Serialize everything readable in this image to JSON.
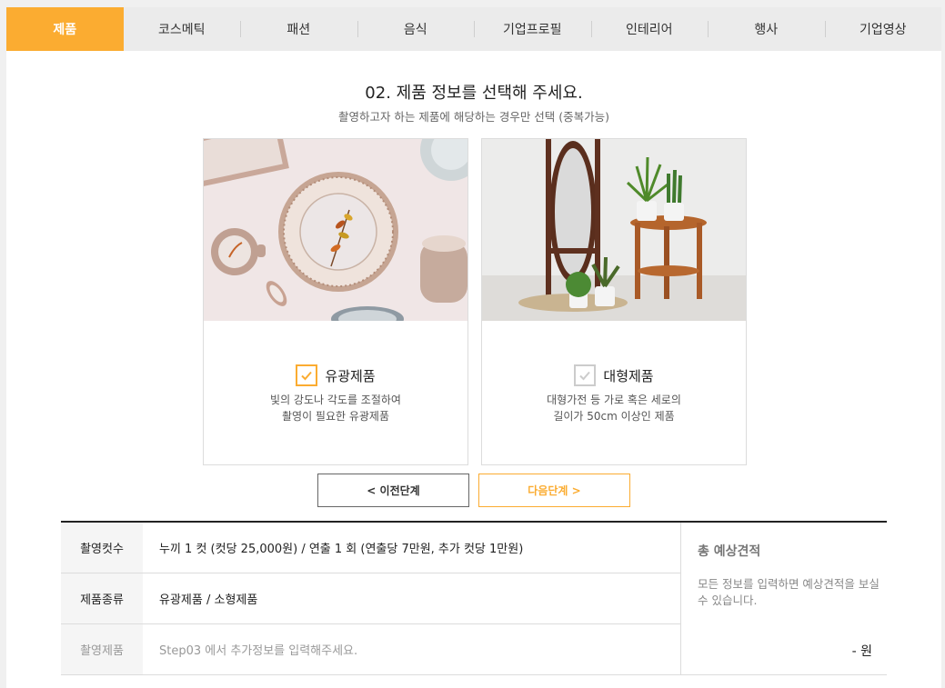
{
  "tabs": [
    {
      "label": "제품",
      "active": true
    },
    {
      "label": "코스메틱"
    },
    {
      "label": "패션"
    },
    {
      "label": "음식"
    },
    {
      "label": "기업프로필"
    },
    {
      "label": "인테리어"
    },
    {
      "label": "행사"
    },
    {
      "label": "기업영상"
    }
  ],
  "step": {
    "title": "02. 제품 정보를 선택해 주세요.",
    "subtitle": "촬영하고자 하는 제품에 해당하는 경우만 선택 (중복가능)"
  },
  "options": [
    {
      "label": "유광제품",
      "desc_line1": "빛의 강도나 각도를 조절하여",
      "desc_line2": "촬영이 필요한 유광제품",
      "checked": true,
      "photo": "ceramic-tableware-photo"
    },
    {
      "label": "대형제품",
      "desc_line1": "대형가전 등 가로 혹은 세로의",
      "desc_line2": "길이가 50cm 이상인 제품",
      "checked": false,
      "photo": "mirror-plant-stand-photo"
    }
  ],
  "buttons": {
    "prev": "< 이전단계",
    "next": "다음단계 >"
  },
  "summary": {
    "rows": [
      {
        "label": "촬영컷수",
        "value": "누끼 1 컷 (컷당 25,000원) / 연출 1 회 (연출당 7만원, 추가 컷당 1만원)"
      },
      {
        "label": "제품종류",
        "value": "유광제품 / 소형제품"
      },
      {
        "label": "촬영제품",
        "value": "Step03 에서 추가정보를 입력해주세요."
      }
    ],
    "total_title": "총 예상견적",
    "total_note": "모든 정보를 입력하면 예상견적을 보실 수 있습니다.",
    "total_amount": "- 원"
  },
  "colors": {
    "accent": "#fbac31",
    "tab_bg": "#ebebeb",
    "check_off": "#cccccc"
  }
}
